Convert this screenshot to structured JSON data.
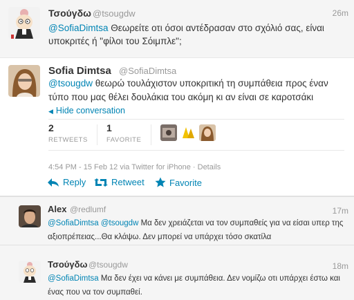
{
  "tweets": {
    "top": {
      "name": "Τσούγδω",
      "handle": "@tsougdw",
      "time": "26m",
      "mention": "@SofiaDimtsa",
      "text": " Θεωρείτε οτι όσοι αντέδρασαν στο σχόλιό σας, είναι υποκριτές ή \"φίλοι του Σόιμπλε\";"
    },
    "main": {
      "name": "Sofia Dimtsa",
      "handle": "@SofiaDimtsa",
      "mention": "@tsougdw",
      "text": " θεωρώ τουλάχιστον υποκριτική τη συμπάθεια προς έναν τύπο που μας θέλει δουλάκια του ακόμη κι αν είναι σε καροτσάκι",
      "hide_conversation": "Hide conversation",
      "retweets": {
        "count": "2",
        "label": "RETWEETS"
      },
      "favorites": {
        "count": "1",
        "label": "FAVORITE"
      },
      "meta": "4:54 PM - 15 Feb 12 via Twitter for iPhone · Details",
      "actions": {
        "reply": "Reply",
        "retweet": "Retweet",
        "favorite": "Favorite"
      }
    }
  },
  "replies": [
    {
      "name": "Alex",
      "handle": "@redlumf",
      "time": "17m",
      "mention1": "@SofiaDimtsa",
      "mention2": "@tsougdw",
      "text": " Μα δεν χρειάζεται να τον συμπαθείς για να είσαι υπερ της αξιοπρέπειας...Θα κλάψω. Δεν μπορεί να υπάρχει τόσο σκατίλα"
    },
    {
      "name": "Τσούγδω",
      "handle": "@tsougdw",
      "time": "18m",
      "mention1": "@SofiaDimtsa",
      "text": " Μα δεν έχει να κάνει με συμπάθεια. Δεν νομίζω οτι υπάρχει έστω και ένας που να τον συμπαθεί."
    }
  ],
  "colors": {
    "link": "#0084b4",
    "muted": "#999999",
    "text": "#333333"
  },
  "icons": [
    "reply-arrow-icon",
    "retweet-icon",
    "star-icon",
    "chevron-left-icon"
  ]
}
